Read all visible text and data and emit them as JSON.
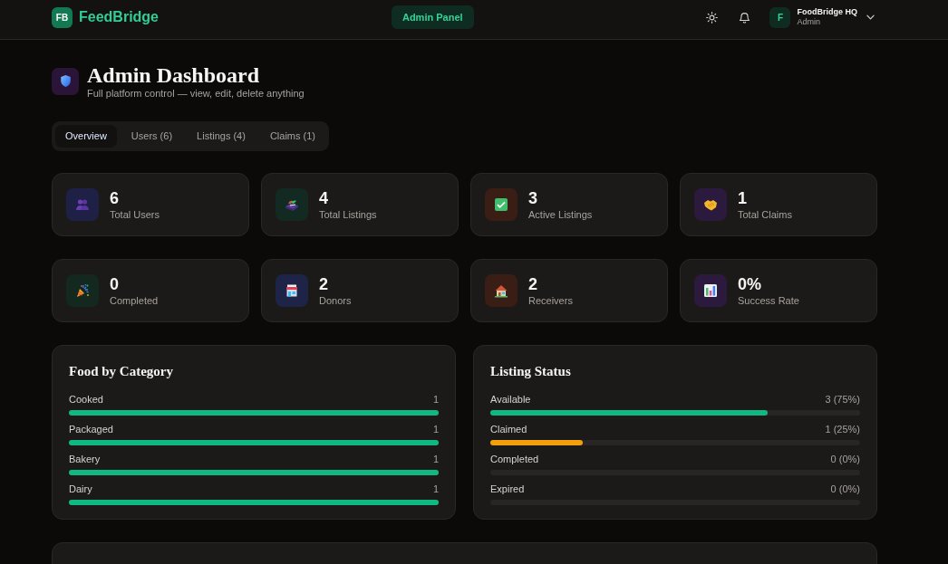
{
  "header": {
    "logo_mark": "FB",
    "brand": "FeedBridge",
    "center_button": "Admin Panel",
    "user": {
      "avatar_letter": "F",
      "name": "FoodBridge HQ",
      "role": "Admin"
    }
  },
  "page": {
    "title": "Admin Dashboard",
    "subtitle": "Full platform control — view, edit, delete anything"
  },
  "tabs": [
    {
      "label": "Overview",
      "selected": true
    },
    {
      "label": "Users (6)",
      "selected": false
    },
    {
      "label": "Listings (4)",
      "selected": false
    },
    {
      "label": "Claims (1)",
      "selected": false
    }
  ],
  "stats": [
    {
      "value": "6",
      "label": "Total Users",
      "color": "#1f2045"
    },
    {
      "value": "4",
      "label": "Total Listings",
      "color": "#132a22"
    },
    {
      "value": "3",
      "label": "Active Listings",
      "color": "#3a1e15"
    },
    {
      "value": "1",
      "label": "Total Claims",
      "color": "#2b1a3d"
    },
    {
      "value": "0",
      "label": "Completed",
      "color": "#13291f"
    },
    {
      "value": "2",
      "label": "Donors",
      "color": "#1e2447"
    },
    {
      "value": "2",
      "label": "Receivers",
      "color": "#3a1e15"
    },
    {
      "value": "0%",
      "label": "Success Rate",
      "color": "#2b1a3d"
    }
  ],
  "food_by_category": {
    "title": "Food by Category",
    "rows": [
      {
        "label": "Cooked",
        "value": "1",
        "level": 1
      },
      {
        "label": "Packaged",
        "value": "1",
        "level": 1
      },
      {
        "label": "Bakery",
        "value": "1",
        "level": 1
      },
      {
        "label": "Dairy",
        "value": "1",
        "level": 1
      }
    ]
  },
  "listing_status": {
    "title": "Listing Status",
    "rows": [
      {
        "label": "Available",
        "value": "3 (75%)",
        "level": 0.75,
        "color": "#10b981"
      },
      {
        "label": "Claimed",
        "value": "1 (25%)",
        "level": 0.25,
        "color": "#f59e0b"
      },
      {
        "label": "Completed",
        "value": "0 (0%)"
      },
      {
        "label": "Expired",
        "value": "0 (0%)"
      }
    ]
  }
}
